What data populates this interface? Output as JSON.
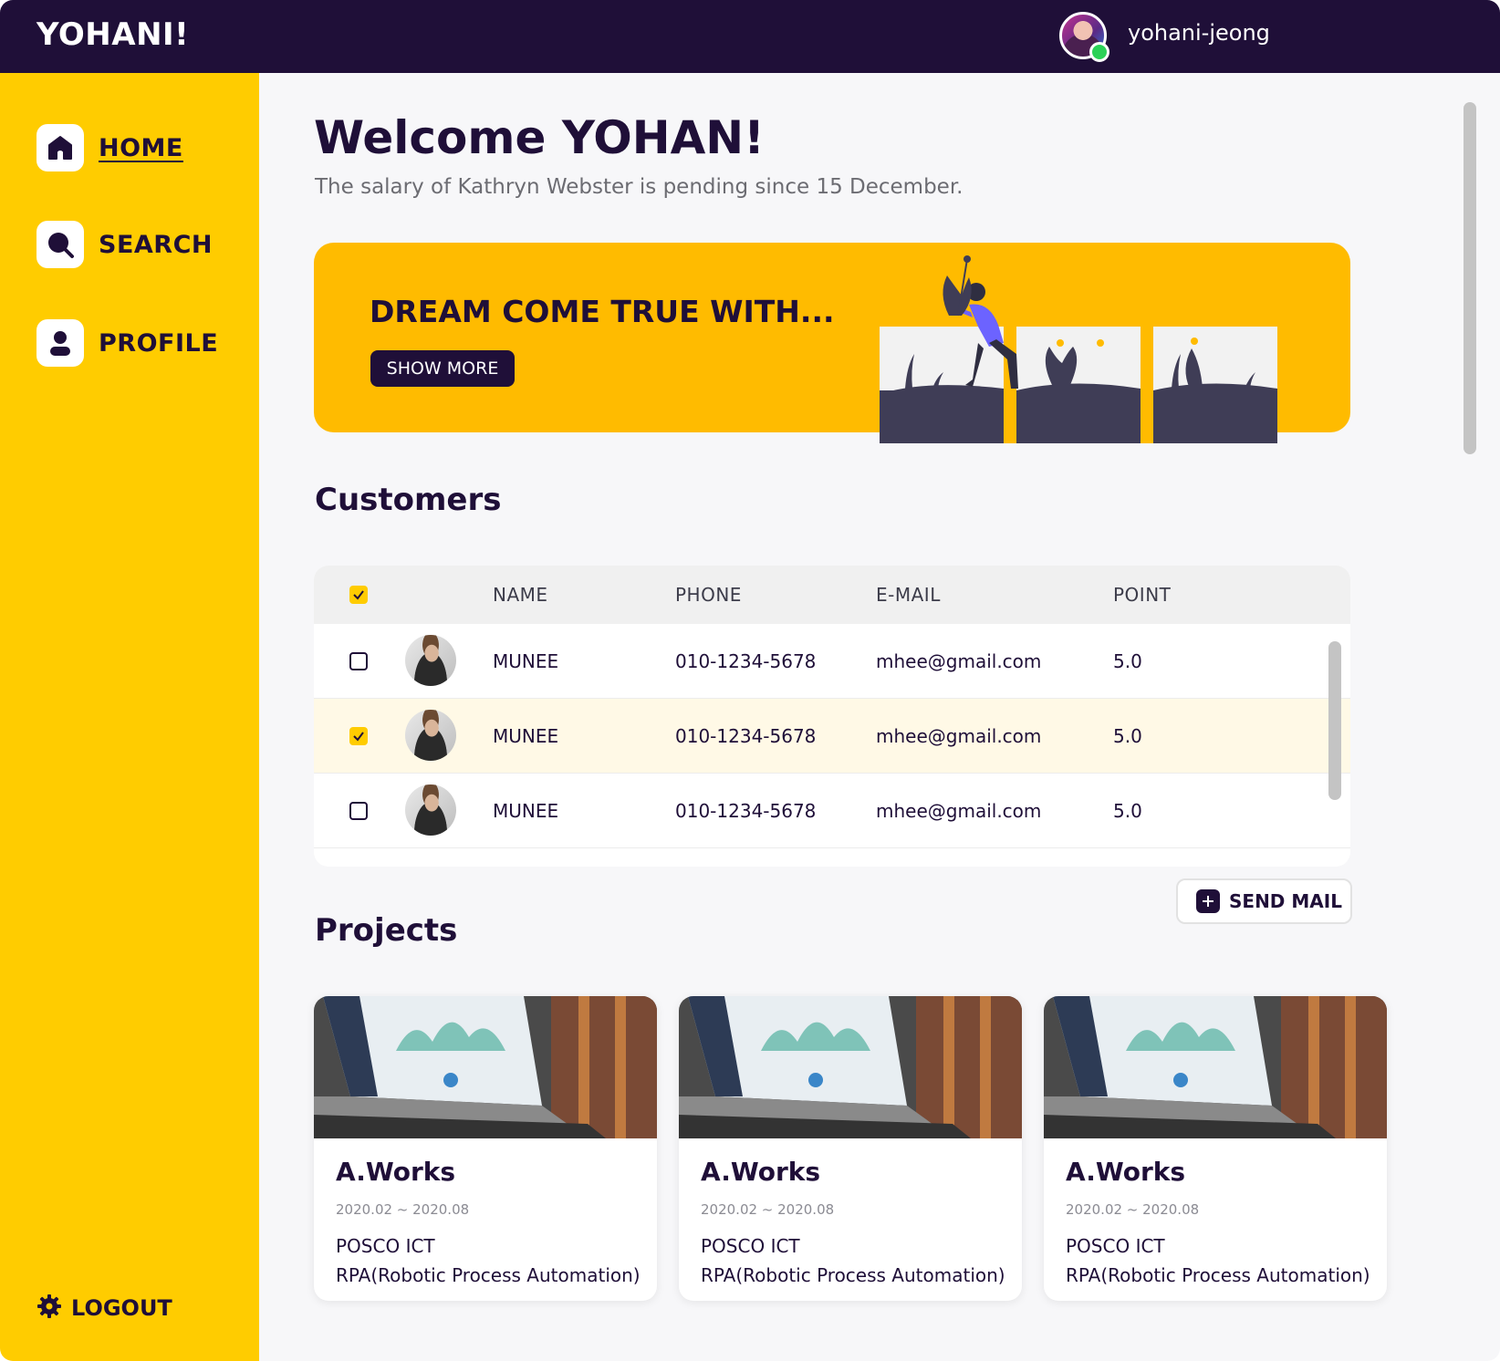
{
  "app": {
    "brand": "YOHANI!"
  },
  "header": {
    "username": "yohani-jeong",
    "status": "online"
  },
  "sidebar": {
    "items": [
      {
        "label": "HOME",
        "icon": "home-icon",
        "active": true
      },
      {
        "label": "SEARCH",
        "icon": "search-icon",
        "active": false
      },
      {
        "label": "PROFILE",
        "icon": "user-icon",
        "active": false
      }
    ],
    "logout_label": "LOGOUT"
  },
  "main": {
    "welcome": "Welcome YOHAN!",
    "subtitle": "The salary of Kathryn Webster is pending since 15 December.",
    "banner": {
      "title": "DREAM COME TRUE WITH...",
      "button_label": "SHOW MORE"
    },
    "customers": {
      "title": "Customers",
      "columns": [
        "NAME",
        "PHONE",
        "E-MAIL",
        "POINT"
      ],
      "header_checked": true,
      "rows": [
        {
          "checked": false,
          "name": "MUNEE",
          "phone": "010-1234-5678",
          "email": "mhee@gmail.com",
          "point": "5.0"
        },
        {
          "checked": true,
          "name": "MUNEE",
          "phone": "010-1234-5678",
          "email": "mhee@gmail.com",
          "point": "5.0"
        },
        {
          "checked": false,
          "name": "MUNEE",
          "phone": "010-1234-5678",
          "email": "mhee@gmail.com",
          "point": "5.0"
        }
      ],
      "send_mail_label": "SEND MAIL"
    },
    "projects": {
      "title": "Projects",
      "items": [
        {
          "title": "A.Works",
          "date": "2020.02 ~ 2020.08",
          "company": "POSCO ICT",
          "description": "RPA(Robotic Process Automation)"
        },
        {
          "title": "A.Works",
          "date": "2020.02 ~ 2020.08",
          "company": "POSCO ICT",
          "description": "RPA(Robotic Process Automation)"
        },
        {
          "title": "A.Works",
          "date": "2020.02 ~ 2020.08",
          "company": "POSCO ICT",
          "description": "RPA(Robotic Process Automation)"
        }
      ]
    }
  },
  "colors": {
    "primary_dark": "#1f0f38",
    "accent_yellow": "#ffcc00",
    "banner_orange": "#ffbb00",
    "online_green": "#2bd157"
  }
}
